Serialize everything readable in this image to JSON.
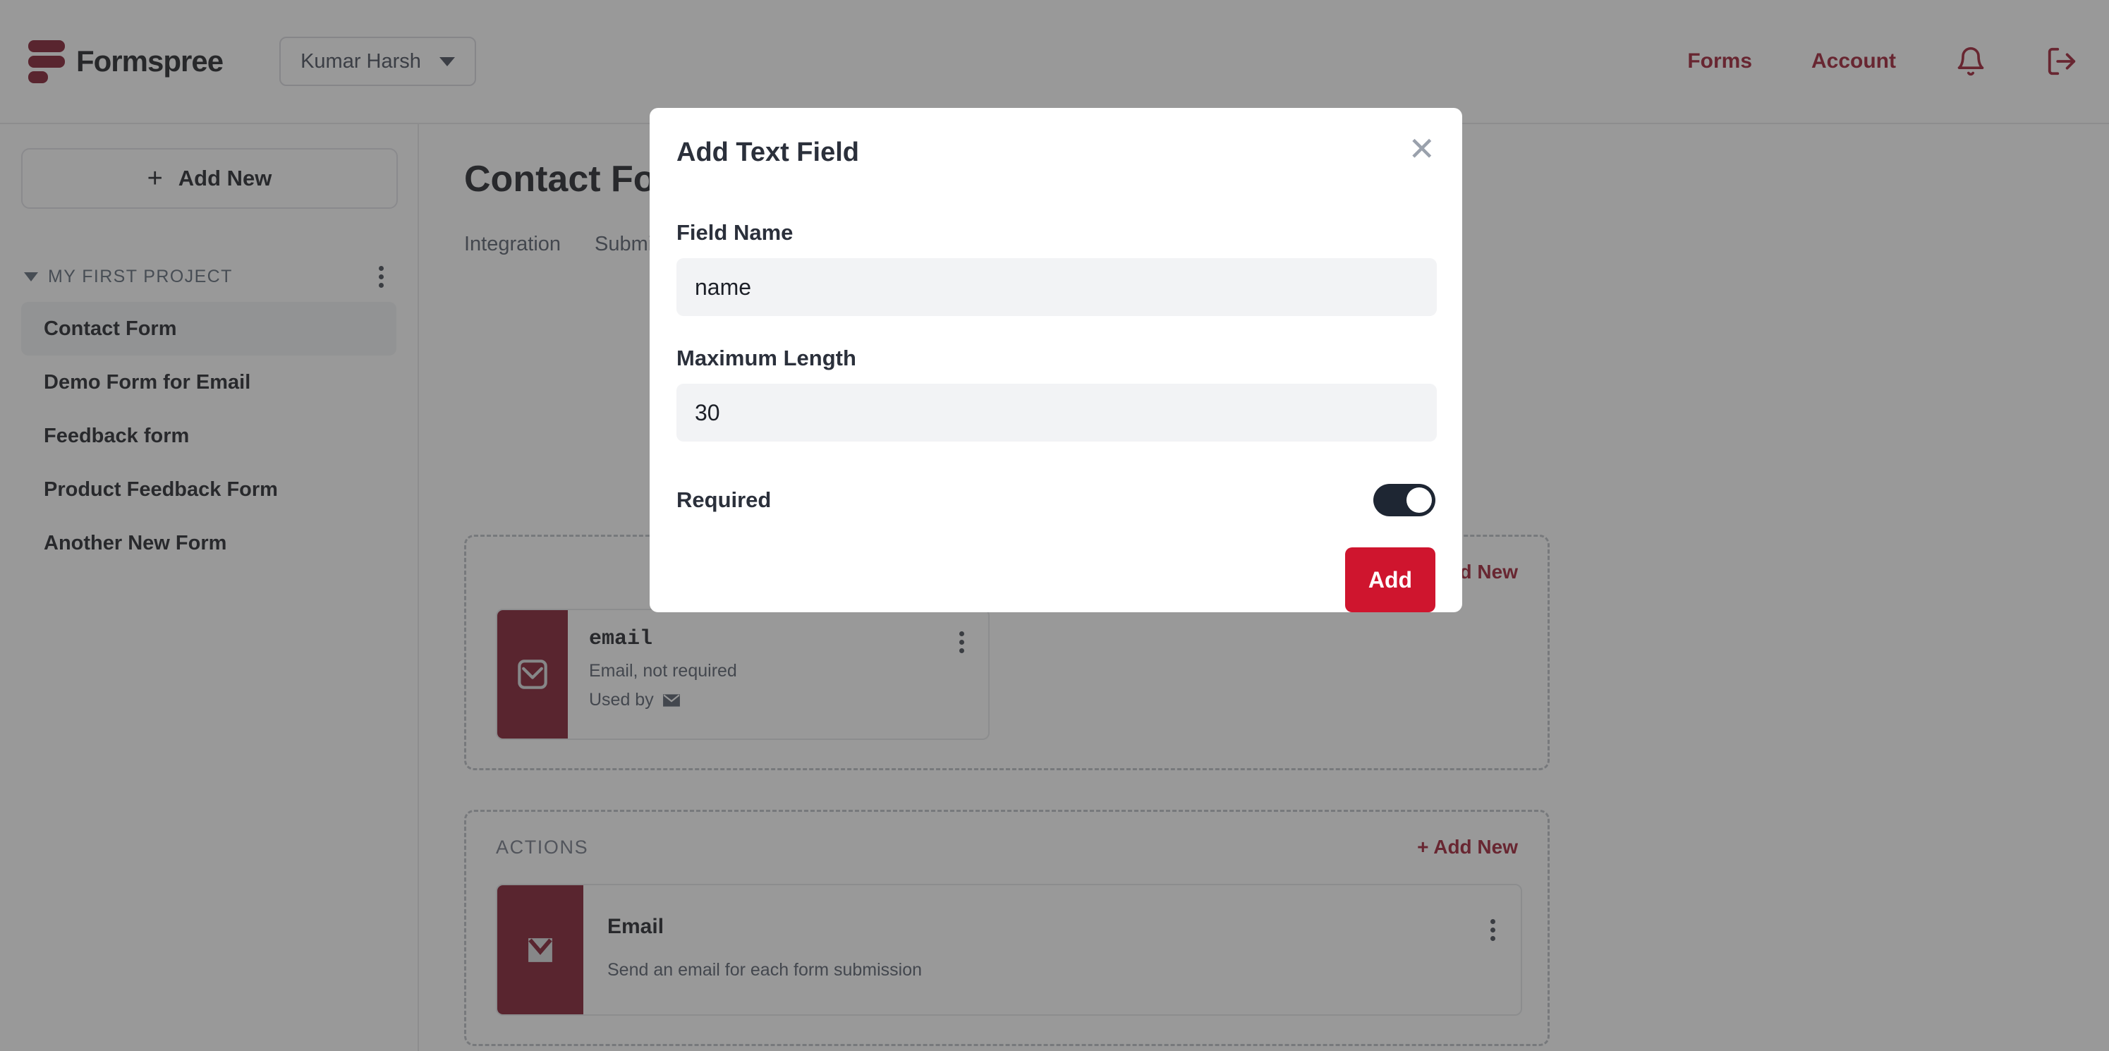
{
  "header": {
    "brand_name": "Formspree",
    "logo_icon": "formspree-logo-icon",
    "account_switcher": {
      "label": "Kumar Harsh",
      "chevron_icon": "chevron-down-icon"
    },
    "nav": [
      {
        "label": "Forms",
        "name": "nav-forms"
      },
      {
        "label": "Account",
        "name": "nav-account"
      }
    ],
    "notifications_icon": "bell-icon",
    "logout_icon": "logout-icon",
    "accent_color": "#9a1026"
  },
  "sidebar": {
    "add_new": {
      "label": "Add New",
      "icon": "plus-icon"
    },
    "project": {
      "title": "MY FIRST PROJECT",
      "collapse_icon": "triangle-down-icon",
      "menu_icon": "kebab-menu-icon"
    },
    "forms": [
      {
        "label": "Contact Form",
        "active": true
      },
      {
        "label": "Demo Form for Email",
        "active": false
      },
      {
        "label": "Feedback form",
        "active": false
      },
      {
        "label": "Product Feedback Form",
        "active": false
      },
      {
        "label": "Another New Form",
        "active": false
      }
    ]
  },
  "main": {
    "page_title": "Contact Form",
    "tabs": [
      {
        "label": "Integration"
      },
      {
        "label": "Submissions"
      }
    ],
    "fields_section": {
      "add_new_label": "+ Add New",
      "cards": [
        {
          "name": "email",
          "subtitle": "Email, not required",
          "used_by_label": "Used by",
          "used_by_icon": "envelope-icon",
          "icon": "envelope-icon",
          "menu_icon": "kebab-menu-icon"
        }
      ]
    },
    "flow_arrow_icon": "arrow-down-icon",
    "actions_section": {
      "title": "ACTIONS",
      "add_new_label": "+ Add New",
      "cards": [
        {
          "name": "Email",
          "subtitle": "Send an email for each form submission",
          "icon": "envelope-icon",
          "menu_icon": "kebab-menu-icon"
        }
      ]
    }
  },
  "modal": {
    "title": "Add Text Field",
    "close_icon": "close-icon",
    "field_name": {
      "label": "Field Name",
      "value": "name",
      "placeholder": "Field Name"
    },
    "maximum_length": {
      "label": "Maximum Length",
      "value": "30",
      "placeholder": "Maximum Length"
    },
    "required": {
      "label": "Required",
      "enabled": true
    },
    "submit": {
      "label": "Add",
      "color": "#cf152e"
    }
  }
}
